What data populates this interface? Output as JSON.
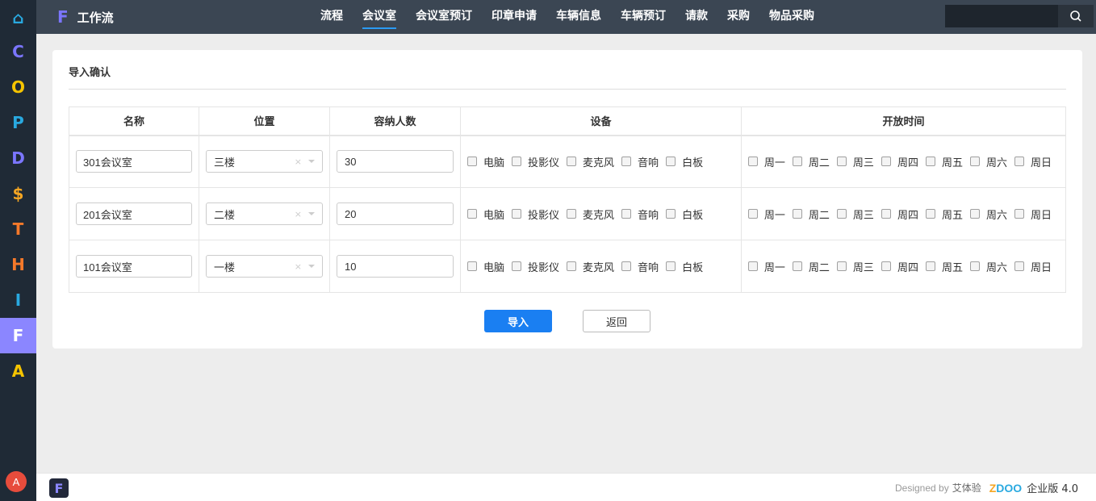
{
  "rail": {
    "items": [
      {
        "glyph": "⌂",
        "color": "#29a9e0"
      },
      {
        "glyph": "C",
        "color": "#7b76ff"
      },
      {
        "glyph": "O",
        "color": "#f5c400"
      },
      {
        "glyph": "P",
        "color": "#29a9e0"
      },
      {
        "glyph": "D",
        "color": "#7b76ff"
      },
      {
        "glyph": "$",
        "color": "#f5a623"
      },
      {
        "glyph": "T",
        "color": "#f5792a"
      },
      {
        "glyph": "H",
        "color": "#f5792a"
      },
      {
        "glyph": "I",
        "color": "#29a9e0"
      },
      {
        "glyph": "F",
        "color": "#ffffff",
        "active": true
      },
      {
        "glyph": "A",
        "color": "#f5c400"
      }
    ],
    "avatar": "A"
  },
  "topbar": {
    "brand_letter": "F",
    "brand_name": "工作流",
    "nav": [
      "流程",
      "会议室",
      "会议室预订",
      "印章申请",
      "车辆信息",
      "车辆预订",
      "请款",
      "采购",
      "物品采购"
    ],
    "active_nav": "会议室",
    "search_placeholder": ""
  },
  "page": {
    "title": "导入确认",
    "columns": [
      "名称",
      "位置",
      "容纳人数",
      "设备",
      "开放时间"
    ],
    "equipment": [
      "电脑",
      "投影仪",
      "麦克风",
      "音响",
      "白板"
    ],
    "weekdays": [
      "周一",
      "周二",
      "周三",
      "周四",
      "周五",
      "周六",
      "周日"
    ],
    "rows": [
      {
        "name": "301会议室",
        "location": "三楼",
        "capacity": "30"
      },
      {
        "name": "201会议室",
        "location": "二楼",
        "capacity": "20"
      },
      {
        "name": "101会议室",
        "location": "一楼",
        "capacity": "10"
      }
    ],
    "import_label": "导入",
    "back_label": "返回"
  },
  "footer": {
    "designed_by": "Designed by",
    "owner": "艾体验",
    "brand": "ZDOO",
    "edition": "企业版 4.0"
  },
  "colors": {
    "accent": "#1a7ff2",
    "rail_bg": "#1f2a36",
    "topbar_bg": "#3b4653",
    "rail_active": "#8b86ff"
  }
}
